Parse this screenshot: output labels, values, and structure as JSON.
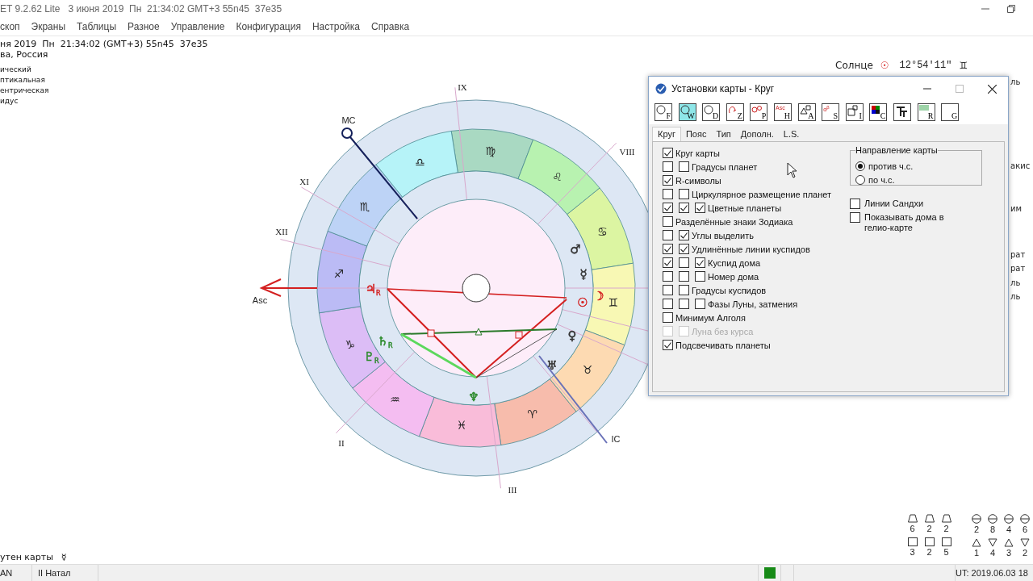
{
  "window": {
    "title": "ET 9.2.62 Lite   3 июня 2019  Пн  21:34:02 GMT+3 55n45  37e35"
  },
  "menu": [
    "скоп",
    "Экраны",
    "Таблицы",
    "Разное",
    "Управление",
    "Конфигурация",
    "Настройка",
    "Справка"
  ],
  "chart_info": {
    "lines": [
      "ня 2019  Пн  21:34:02 (GMT+3) 55n45  37e35",
      "ва, Россия"
    ],
    "settings": [
      "ический",
      "птикальная",
      "ентрическая",
      "идус"
    ]
  },
  "sun_readout": {
    "label": "Солнце",
    "planet": "☉",
    "value": "12°54'11\"",
    "sign": "♊"
  },
  "chart": {
    "signs": [
      {
        "glyph": "♍",
        "color": "#a9d9c2"
      },
      {
        "glyph": "♌",
        "color": "#b8f2b0"
      },
      {
        "glyph": "♋",
        "color": "#dcf5a2"
      },
      {
        "glyph": "♊",
        "color": "#f8f8b4"
      },
      {
        "glyph": "♉",
        "color": "#fddab2"
      },
      {
        "glyph": "♈",
        "color": "#f7bcac"
      },
      {
        "glyph": "♓",
        "color": "#f9bcd9"
      },
      {
        "glyph": "♒",
        "color": "#f4bdf1"
      },
      {
        "glyph": "♑",
        "color": "#dcbdf6"
      },
      {
        "glyph": "♐",
        "color": "#bbbbf5"
      },
      {
        "glyph": "♏",
        "color": "#bdd3f6"
      },
      {
        "glyph": "♎",
        "color": "#b6f3f8"
      }
    ],
    "house_labels": [
      "IX",
      "VIII",
      "XI",
      "XII",
      "II",
      "III"
    ],
    "angles": [
      "MC",
      "Asc",
      "IC"
    ],
    "planets": [
      {
        "glyph": "♂",
        "color": "#333333"
      },
      {
        "glyph": "☿",
        "color": "#333333"
      },
      {
        "glyph": "☉",
        "color": "#d42020"
      },
      {
        "glyph": "☽",
        "color": "#d42020"
      },
      {
        "glyph": "♀",
        "color": "#333333"
      },
      {
        "glyph": "♅",
        "color": "#333333"
      },
      {
        "glyph": "♆",
        "color": "#2a8a2a"
      },
      {
        "glyph": "♃$_{R}$",
        "color": "#d42020"
      },
      {
        "glyph": "♄$_{R}$",
        "color": "#2a8a2a"
      },
      {
        "glyph": "♇$_{R}$",
        "color": "#2a8a2a"
      }
    ]
  },
  "right_fragments": [
    "ль",
    "акис",
    "им",
    "рат",
    "рат",
    "ль",
    "ль"
  ],
  "dialog": {
    "title": "Установки карты - Круг",
    "toolbar": [
      {
        "kind": "ring",
        "letter": "F",
        "selected": false
      },
      {
        "kind": "ring",
        "letter": "W",
        "selected": true
      },
      {
        "kind": "ring",
        "letter": "D",
        "selected": false
      },
      {
        "kind": "sign",
        "letter": "Z",
        "selected": false
      },
      {
        "kind": "planets",
        "letter": "P",
        "selected": false
      },
      {
        "kind": "caption",
        "caption": "Asc",
        "letter": "H",
        "selected": false
      },
      {
        "kind": "shapes",
        "letter": "A",
        "selected": false
      },
      {
        "kind": "caption",
        "caption": "α$^{β}$",
        "letter": "S",
        "selected": false
      },
      {
        "kind": "boxes",
        "letter": "I",
        "selected": false
      },
      {
        "kind": "colors",
        "letter": "C",
        "selected": false
      },
      {
        "kind": "font",
        "selected": false
      },
      {
        "kind": "image",
        "letter": "R",
        "selected": false
      },
      {
        "kind": "blank",
        "letter": "G",
        "selected": false
      }
    ],
    "tabs": [
      {
        "label": "Круг",
        "selected": true
      },
      {
        "label": "Пояс",
        "selected": false
      },
      {
        "label": "Тип",
        "selected": false
      },
      {
        "label": "Дополн.",
        "selected": false
      },
      {
        "label": "L.S.",
        "selected": false
      }
    ],
    "options": [
      {
        "label": "Круг карты",
        "disabled": false,
        "boxes": [
          {
            "checked": true
          }
        ]
      },
      {
        "label": "Градусы планет",
        "disabled": false,
        "boxes": [
          {
            "checked": false
          },
          {
            "checked": false
          }
        ]
      },
      {
        "label": "R-символы",
        "disabled": false,
        "boxes": [
          {
            "checked": true
          }
        ]
      },
      {
        "label": "Циркулярное размещение планет",
        "disabled": false,
        "boxes": [
          {
            "checked": false
          },
          {
            "checked": false
          }
        ]
      },
      {
        "label": "Цветные планеты",
        "disabled": false,
        "boxes": [
          {
            "checked": true
          },
          {
            "checked": true
          },
          {
            "checked": true
          }
        ]
      },
      {
        "label": "Разделённые знаки Зодиака",
        "disabled": false,
        "boxes": [
          {
            "checked": false
          }
        ]
      },
      {
        "label": "Углы выделить",
        "disabled": false,
        "boxes": [
          {
            "checked": false
          },
          {
            "checked": true
          }
        ]
      },
      {
        "label": "Удлинённые линии куспидов",
        "disabled": false,
        "boxes": [
          {
            "checked": true
          },
          {
            "checked": true
          }
        ]
      },
      {
        "label": "Куспид дома",
        "disabled": false,
        "boxes": [
          {
            "checked": true
          },
          {
            "checked": false
          },
          {
            "checked": true
          }
        ]
      },
      {
        "label": "Номер дома",
        "disabled": false,
        "boxes": [
          {
            "checked": false
          },
          {
            "checked": false
          },
          {
            "checked": false
          }
        ]
      },
      {
        "label": "Градусы куспидов",
        "disabled": false,
        "boxes": [
          {
            "checked": false
          },
          {
            "checked": false
          }
        ]
      },
      {
        "label": "Фазы Луны, затмения",
        "disabled": false,
        "boxes": [
          {
            "checked": false
          },
          {
            "checked": false
          },
          {
            "checked": false
          }
        ]
      },
      {
        "label": "Минимум Алголя",
        "disabled": false,
        "boxes": [
          {
            "checked": false
          }
        ]
      },
      {
        "label": "Луна без курса",
        "disabled": true,
        "boxes": [
          {
            "checked": false
          },
          {
            "checked": false
          }
        ]
      },
      {
        "label": "Подсвечивать планеты",
        "disabled": false,
        "boxes": [
          {
            "checked": true
          }
        ]
      }
    ],
    "direction": {
      "label": "Направление карты",
      "options": [
        {
          "label": "против ч.с.",
          "selected": true
        },
        {
          "label": "по ч.с.",
          "selected": false
        }
      ]
    },
    "extra_options": [
      {
        "label": "Линии Сандхи",
        "checked": false
      },
      {
        "label": "Показывать дома в гелио-карте",
        "checked": false
      }
    ]
  },
  "stats": [
    {
      "rows": [
        {
          "kind": "trapezoid",
          "values": [
            "6",
            "2",
            "2"
          ]
        },
        {
          "kind": "square",
          "values": [
            "3",
            "2",
            "5"
          ]
        }
      ]
    },
    {
      "rows": [
        {
          "kind": "circle",
          "values": [
            "2",
            "8",
            "4",
            "6"
          ]
        },
        {
          "kind": "triangle",
          "values": [
            "1",
            "4",
            "3",
            "2"
          ]
        }
      ]
    }
  ],
  "chart_owner": {
    "label": "утен карты",
    "glyph": "☿"
  },
  "status_bar": {
    "left": "AN",
    "mode": "II Натал",
    "indicator_on": true,
    "time": "UT: 2019.06.03 18"
  }
}
